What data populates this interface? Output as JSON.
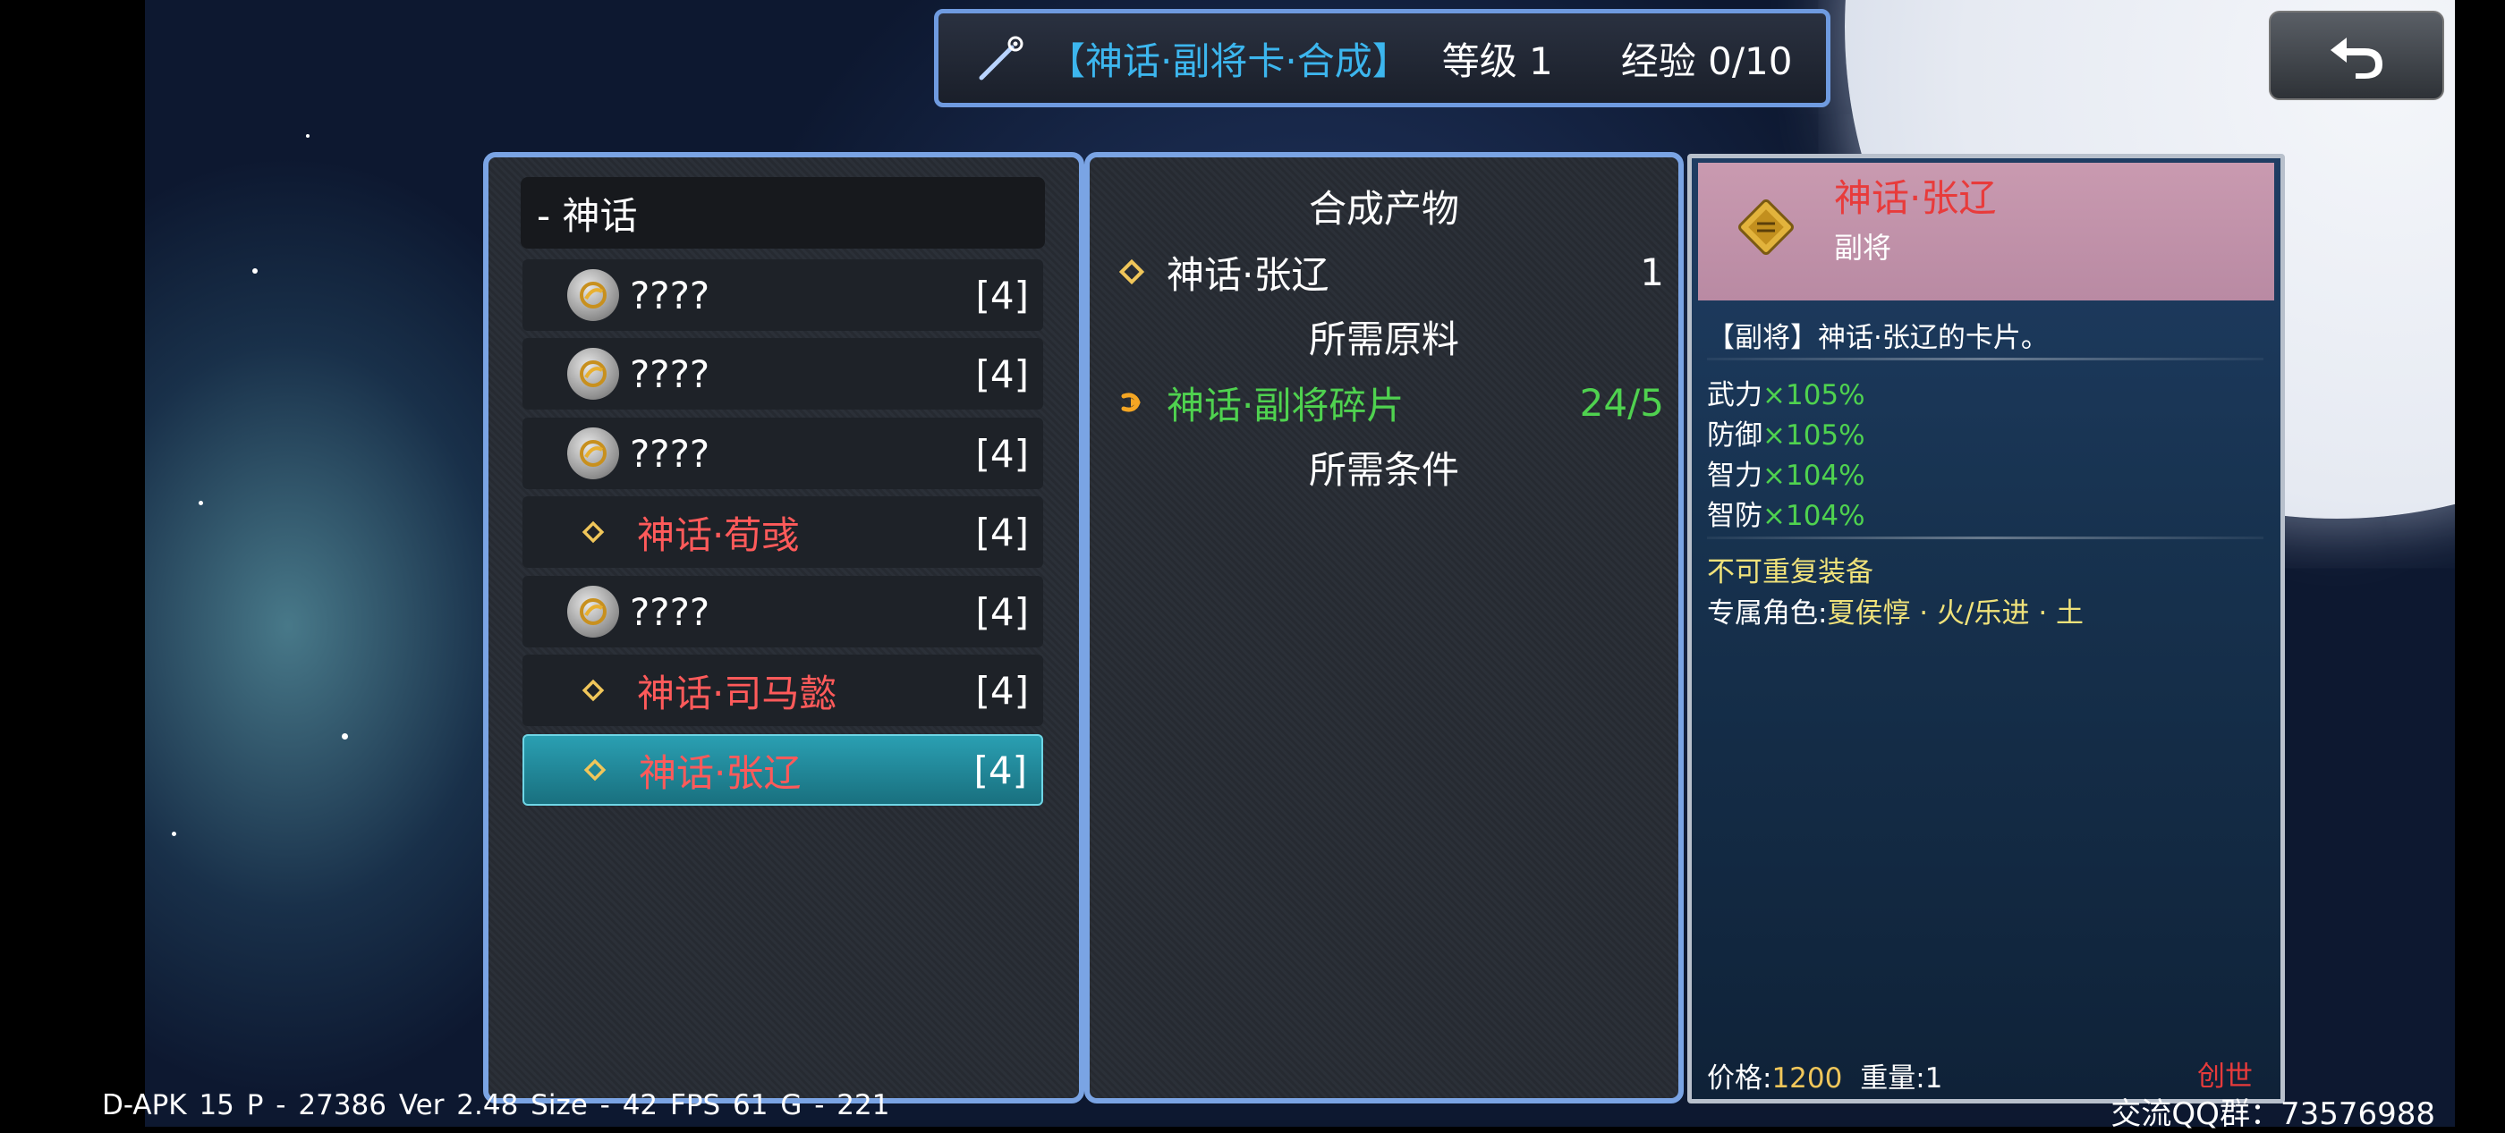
{
  "header": {
    "title": "【神话·副将卡·合成】",
    "level": "等级 1",
    "exp": "经验 0/10",
    "wand_icon": "magic-wand-icon",
    "back_icon": "return-arrow-icon"
  },
  "category": {
    "label": "- 神话"
  },
  "list": [
    {
      "name": "????",
      "count": "[4]",
      "icon": "coin-icon",
      "color": "#ffffff"
    },
    {
      "name": "????",
      "count": "[4]",
      "icon": "coin-icon",
      "color": "#ffffff"
    },
    {
      "name": "????",
      "count": "[4]",
      "icon": "coin-icon",
      "color": "#ffffff"
    },
    {
      "name": "神话·荀彧",
      "count": "[4]",
      "icon": "diamond-icon",
      "color": "#ff5a5a"
    },
    {
      "name": "????",
      "count": "[4]",
      "icon": "coin-icon",
      "color": "#ffffff"
    },
    {
      "name": "神话·司马懿",
      "count": "[4]",
      "icon": "diamond-icon",
      "color": "#ff5a5a"
    },
    {
      "name": "神话·张辽",
      "count": "[4]",
      "icon": "diamond-icon",
      "color": "#ff5a5a",
      "selected": true
    }
  ],
  "synthesis": {
    "product_heading": "合成产物",
    "product_name": "神话·张辽",
    "product_qty": "1",
    "material_heading": "所需原料",
    "material_name": "神话·副将碎片",
    "material_qty": "24/5",
    "condition_heading": "所需条件"
  },
  "info": {
    "name": "神话·张辽",
    "type": "副将",
    "description": "【副将】神话·张辽的卡片。",
    "stats": [
      {
        "label": "武力",
        "value": "×105%"
      },
      {
        "label": "防御",
        "value": "×105%"
      },
      {
        "label": "智力",
        "value": "×104%"
      },
      {
        "label": "智防",
        "value": "×104%"
      }
    ],
    "restriction": "不可重复装备",
    "exclusive_label": "专属角色:",
    "exclusive_value": "夏侯惇 · 火/乐进 · 土",
    "price_label": "价格:",
    "price_value": "1200",
    "weight_label": "重量:",
    "weight_value": "1",
    "source": "创世"
  },
  "footer": {
    "debug": "D-APK 15   P - 27386   Ver 2.48   Size - 42   FPS 61   G - 221",
    "qq_group": "交流QQ群：73576988"
  },
  "colors": {
    "accent_blue": "#3cb6ee",
    "name_red": "#ff5a5a",
    "stat_green": "#4fd24f",
    "gold": "#f0c65a",
    "panel_border": "#7aa4e4"
  }
}
